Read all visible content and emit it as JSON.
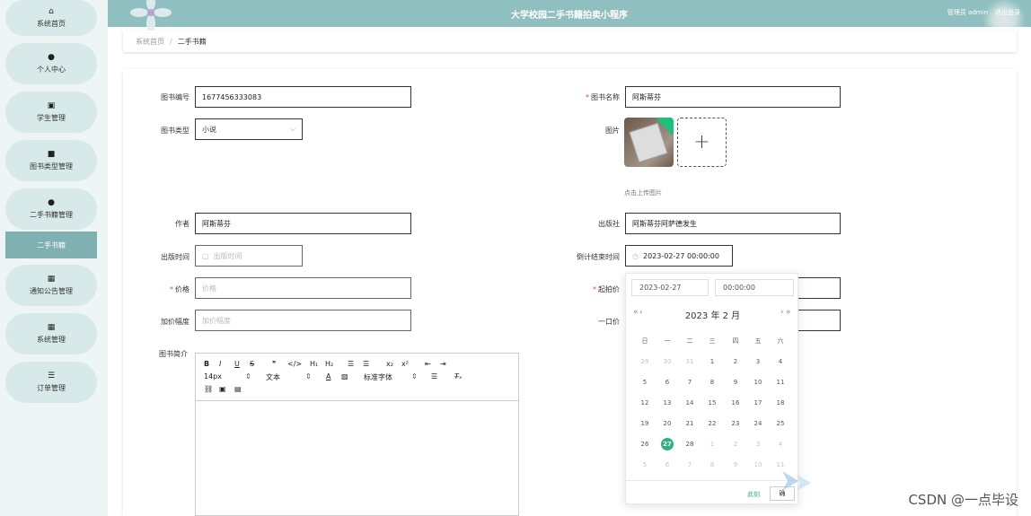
{
  "sidebar": {
    "items": [
      {
        "label": "系统首页",
        "icon": "home-icon"
      },
      {
        "label": "个人中心",
        "icon": "user-icon"
      },
      {
        "label": "学生管理",
        "icon": "clipboard-icon"
      },
      {
        "label": "图书类型管理",
        "icon": "video-icon"
      },
      {
        "label": "二手书籍管理",
        "icon": "user-icon"
      },
      {
        "label": "通知公告管理",
        "icon": "grid-icon"
      },
      {
        "label": "系统管理",
        "icon": "grid-icon"
      },
      {
        "label": "订单管理",
        "icon": "list-icon"
      }
    ],
    "active_sub": "二手书籍"
  },
  "header": {
    "title": "大学校园二手书籍拍卖小程序",
    "user": "管理员 admin",
    "logout": "退出登录"
  },
  "breadcrumb": {
    "home": "系统首页",
    "sep": "/",
    "current": "二手书籍"
  },
  "form": {
    "book_no_label": "图书编号",
    "book_no": "1677456333083",
    "book_name_label": "图书名称",
    "book_name": "阿斯蒂芬",
    "book_type_label": "图书类型",
    "book_type": "小说",
    "image_label": "图片",
    "upload_tip": "点击上传图片",
    "author_label": "作者",
    "author": "阿斯蒂芬",
    "publisher_label": "出版社",
    "publisher": "阿斯蒂芬阿萨德发生",
    "pub_time_label": "出版时间",
    "pub_time_placeholder": "出版时间",
    "countdown_label": "倒计结束时间",
    "countdown_value": "2023-02-27 00:00:00",
    "price_label": "价格",
    "price_placeholder": "价格",
    "start_price_label": "起拍价",
    "increment_label": "加价幅度",
    "increment_placeholder": "加价幅度",
    "fixed_price_label": "一口价",
    "intro_label": "图书简介"
  },
  "editor": {
    "font_size": "14px",
    "format": "文本",
    "font_family": "标准字体"
  },
  "datepicker": {
    "date_input": "2023-02-27",
    "time_input": "00:00:00",
    "title": "2023 年  2 月",
    "weekdays": [
      "日",
      "一",
      "二",
      "三",
      "四",
      "五",
      "六"
    ],
    "rows": [
      [
        "29",
        "30",
        "31",
        "1",
        "2",
        "3",
        "4"
      ],
      [
        "5",
        "6",
        "7",
        "8",
        "9",
        "10",
        "11"
      ],
      [
        "12",
        "13",
        "14",
        "15",
        "16",
        "17",
        "18"
      ],
      [
        "19",
        "20",
        "21",
        "22",
        "23",
        "24",
        "25"
      ],
      [
        "26",
        "27",
        "28",
        "1",
        "2",
        "3",
        "4"
      ],
      [
        "5",
        "6",
        "7",
        "8",
        "9",
        "10",
        "11"
      ]
    ],
    "selected": "27",
    "now_label": "此刻",
    "ok_label": "确"
  },
  "watermark": "CSDN @一点毕设"
}
